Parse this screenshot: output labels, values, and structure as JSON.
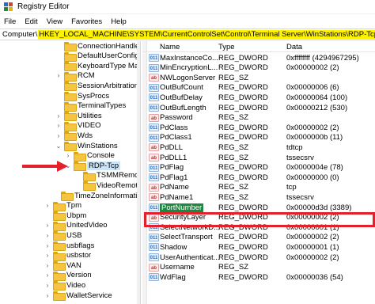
{
  "window": {
    "title": "Registry Editor"
  },
  "menu": [
    "File",
    "Edit",
    "View",
    "Favorites",
    "Help"
  ],
  "address": {
    "prefix": "Computer\\",
    "path": "HKEY_LOCAL_MACHINE\\SYSTEM\\CurrentControlSet\\Control\\Terminal Server\\WinStations\\RDP-Tcp"
  },
  "tree": [
    {
      "label": "ConnectionHandle",
      "chev": "",
      "level": 0
    },
    {
      "label": "DefaultUserConfigu",
      "chev": "",
      "level": 0
    },
    {
      "label": "KeyboardType Map",
      "chev": "",
      "level": 0
    },
    {
      "label": "RCM",
      "chev": "›",
      "level": 0
    },
    {
      "label": "SessionArbitrationH",
      "chev": "",
      "level": 0
    },
    {
      "label": "SysProcs",
      "chev": "",
      "level": 0
    },
    {
      "label": "TerminalTypes",
      "chev": "",
      "level": 0
    },
    {
      "label": "Utilities",
      "chev": "›",
      "level": 0
    },
    {
      "label": "VIDEO",
      "chev": "›",
      "level": 0
    },
    {
      "label": "Wds",
      "chev": "›",
      "level": 0
    },
    {
      "label": "WinStations",
      "chev": "⌄",
      "level": 0
    },
    {
      "label": "Console",
      "chev": "›",
      "level": 1
    },
    {
      "label": "RDP-Tcp",
      "chev": "⌄",
      "level": 1,
      "selected": true
    },
    {
      "label": "TSMMRemot",
      "chev": "",
      "level": 2
    },
    {
      "label": "VideoRemoti",
      "chev": "",
      "level": 2
    },
    {
      "label": "TimeZoneInformation",
      "chev": "",
      "level": -1
    },
    {
      "label": "Tpm",
      "chev": "›",
      "level": -2
    },
    {
      "label": "Ubpm",
      "chev": "",
      "level": -2
    },
    {
      "label": "UnitedVideo",
      "chev": "›",
      "level": -2
    },
    {
      "label": "USB",
      "chev": "›",
      "level": -2
    },
    {
      "label": "usbflags",
      "chev": "›",
      "level": -2
    },
    {
      "label": "usbstor",
      "chev": "›",
      "level": -2
    },
    {
      "label": "VAN",
      "chev": "›",
      "level": -2
    },
    {
      "label": "Version",
      "chev": "›",
      "level": -2
    },
    {
      "label": "Video",
      "chev": "›",
      "level": -2
    },
    {
      "label": "WalletService",
      "chev": "›",
      "level": -2
    }
  ],
  "list": {
    "headers": {
      "name": "Name",
      "type": "Type",
      "data": "Data"
    },
    "rows": [
      {
        "icon": "bin",
        "name": "MaxInstanceCo...",
        "type": "REG_DWORD",
        "data": "0xffffffff (4294967295)"
      },
      {
        "icon": "bin",
        "name": "MinEncryptionL...",
        "type": "REG_DWORD",
        "data": "0x00000002 (2)"
      },
      {
        "icon": "ab",
        "name": "NWLogonServer",
        "type": "REG_SZ",
        "data": ""
      },
      {
        "icon": "bin",
        "name": "OutBufCount",
        "type": "REG_DWORD",
        "data": "0x00000006 (6)"
      },
      {
        "icon": "bin",
        "name": "OutBufDelay",
        "type": "REG_DWORD",
        "data": "0x00000064 (100)"
      },
      {
        "icon": "bin",
        "name": "OutBufLength",
        "type": "REG_DWORD",
        "data": "0x00000212 (530)"
      },
      {
        "icon": "ab",
        "name": "Password",
        "type": "REG_SZ",
        "data": ""
      },
      {
        "icon": "bin",
        "name": "PdClass",
        "type": "REG_DWORD",
        "data": "0x00000002 (2)"
      },
      {
        "icon": "bin",
        "name": "PdClass1",
        "type": "REG_DWORD",
        "data": "0x0000000b (11)"
      },
      {
        "icon": "ab",
        "name": "PdDLL",
        "type": "REG_SZ",
        "data": "tdtcp"
      },
      {
        "icon": "ab",
        "name": "PdDLL1",
        "type": "REG_SZ",
        "data": "tssecsrv"
      },
      {
        "icon": "bin",
        "name": "PdFlag",
        "type": "REG_DWORD",
        "data": "0x0000004e (78)"
      },
      {
        "icon": "bin",
        "name": "PdFlag1",
        "type": "REG_DWORD",
        "data": "0x00000000 (0)"
      },
      {
        "icon": "ab",
        "name": "PdName",
        "type": "REG_SZ",
        "data": "tcp"
      },
      {
        "icon": "ab",
        "name": "PdName1",
        "type": "REG_SZ",
        "data": "tssecsrv"
      },
      {
        "icon": "bin",
        "name": "PortNumber",
        "type": "REG_DWORD",
        "data": "0x00000d3d (3389)",
        "selected": true
      },
      {
        "icon": "ab",
        "name": "SecurityLayer",
        "type": "REG_DWORD",
        "data": "0x00000002 (2)"
      },
      {
        "icon": "bin",
        "name": "SelectNetworkD...",
        "type": "REG_DWORD",
        "data": "0x00000001 (1)"
      },
      {
        "icon": "bin",
        "name": "SelectTransport",
        "type": "REG_DWORD",
        "data": "0x00000002 (2)"
      },
      {
        "icon": "bin",
        "name": "Shadow",
        "type": "REG_DWORD",
        "data": "0x00000001 (1)"
      },
      {
        "icon": "bin",
        "name": "UserAuthenticat...",
        "type": "REG_DWORD",
        "data": "0x00000002 (2)"
      },
      {
        "icon": "ab",
        "name": "Username",
        "type": "REG_SZ",
        "data": ""
      },
      {
        "icon": "bin",
        "name": "WdFlag",
        "type": "REG_DWORD",
        "data": "0x00000036 (54)"
      }
    ]
  },
  "colors": {
    "address_highlight": "#fff200",
    "annotation": "#e4212b",
    "selected_value": "#1a8a3e"
  }
}
